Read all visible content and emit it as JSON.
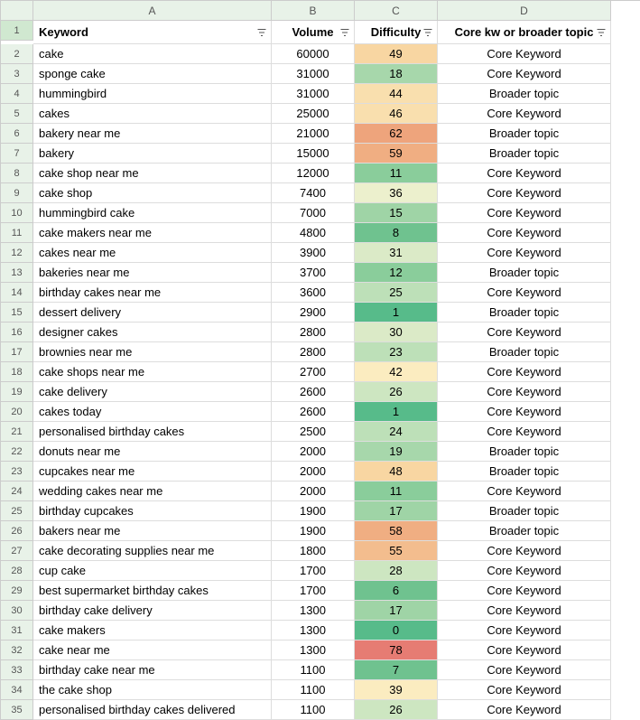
{
  "columns": [
    "A",
    "B",
    "C",
    "D"
  ],
  "headers": {
    "keyword": "Keyword",
    "volume": "Volume",
    "difficulty": "Difficulty",
    "topic": "Core kw or broader topic"
  },
  "rows": [
    {
      "n": 2,
      "keyword": "cake",
      "volume": "60000",
      "difficulty": 49,
      "topic": "Core Keyword"
    },
    {
      "n": 3,
      "keyword": "sponge cake",
      "volume": "31000",
      "difficulty": 18,
      "topic": "Core Keyword"
    },
    {
      "n": 4,
      "keyword": "hummingbird",
      "volume": "31000",
      "difficulty": 44,
      "topic": "Broader topic"
    },
    {
      "n": 5,
      "keyword": "cakes",
      "volume": "25000",
      "difficulty": 46,
      "topic": "Core Keyword"
    },
    {
      "n": 6,
      "keyword": "bakery near me",
      "volume": "21000",
      "difficulty": 62,
      "topic": "Broader topic"
    },
    {
      "n": 7,
      "keyword": "bakery",
      "volume": "15000",
      "difficulty": 59,
      "topic": "Broader topic"
    },
    {
      "n": 8,
      "keyword": "cake shop near me",
      "volume": "12000",
      "difficulty": 11,
      "topic": "Core Keyword"
    },
    {
      "n": 9,
      "keyword": "cake shop",
      "volume": "7400",
      "difficulty": 36,
      "topic": "Core Keyword"
    },
    {
      "n": 10,
      "keyword": "hummingbird cake",
      "volume": "7000",
      "difficulty": 15,
      "topic": "Core Keyword"
    },
    {
      "n": 11,
      "keyword": "cake makers near me",
      "volume": "4800",
      "difficulty": 8,
      "topic": "Core Keyword"
    },
    {
      "n": 12,
      "keyword": "cakes near me",
      "volume": "3900",
      "difficulty": 31,
      "topic": "Core Keyword"
    },
    {
      "n": 13,
      "keyword": "bakeries near me",
      "volume": "3700",
      "difficulty": 12,
      "topic": "Broader topic"
    },
    {
      "n": 14,
      "keyword": "birthday cakes near me",
      "volume": "3600",
      "difficulty": 25,
      "topic": "Core Keyword"
    },
    {
      "n": 15,
      "keyword": "dessert delivery",
      "volume": "2900",
      "difficulty": 1,
      "topic": "Broader topic"
    },
    {
      "n": 16,
      "keyword": "designer cakes",
      "volume": "2800",
      "difficulty": 30,
      "topic": "Core Keyword"
    },
    {
      "n": 17,
      "keyword": "brownies near me",
      "volume": "2800",
      "difficulty": 23,
      "topic": "Broader topic"
    },
    {
      "n": 18,
      "keyword": "cake shops near me",
      "volume": "2700",
      "difficulty": 42,
      "topic": "Core Keyword"
    },
    {
      "n": 19,
      "keyword": "cake delivery",
      "volume": "2600",
      "difficulty": 26,
      "topic": "Core Keyword"
    },
    {
      "n": 20,
      "keyword": "cakes today",
      "volume": "2600",
      "difficulty": 1,
      "topic": "Core Keyword"
    },
    {
      "n": 21,
      "keyword": "personalised birthday cakes",
      "volume": "2500",
      "difficulty": 24,
      "topic": "Core Keyword"
    },
    {
      "n": 22,
      "keyword": "donuts near me",
      "volume": "2000",
      "difficulty": 19,
      "topic": "Broader topic"
    },
    {
      "n": 23,
      "keyword": "cupcakes near me",
      "volume": "2000",
      "difficulty": 48,
      "topic": "Broader topic"
    },
    {
      "n": 24,
      "keyword": "wedding cakes near me",
      "volume": "2000",
      "difficulty": 11,
      "topic": "Core Keyword"
    },
    {
      "n": 25,
      "keyword": "birthday cupcakes",
      "volume": "1900",
      "difficulty": 17,
      "topic": "Broader topic"
    },
    {
      "n": 26,
      "keyword": "bakers near me",
      "volume": "1900",
      "difficulty": 58,
      "topic": "Broader topic"
    },
    {
      "n": 27,
      "keyword": "cake decorating supplies near me",
      "volume": "1800",
      "difficulty": 55,
      "topic": "Core Keyword"
    },
    {
      "n": 28,
      "keyword": "cup cake",
      "volume": "1700",
      "difficulty": 28,
      "topic": "Core Keyword"
    },
    {
      "n": 29,
      "keyword": "best supermarket birthday cakes",
      "volume": "1700",
      "difficulty": 6,
      "topic": "Core Keyword"
    },
    {
      "n": 30,
      "keyword": "birthday cake delivery",
      "volume": "1300",
      "difficulty": 17,
      "topic": "Core Keyword"
    },
    {
      "n": 31,
      "keyword": "cake makers",
      "volume": "1300",
      "difficulty": 0,
      "topic": "Core Keyword"
    },
    {
      "n": 32,
      "keyword": "cake near me",
      "volume": "1300",
      "difficulty": 78,
      "topic": "Core Keyword"
    },
    {
      "n": 33,
      "keyword": "birthday cake near me",
      "volume": "1100",
      "difficulty": 7,
      "topic": "Core Keyword"
    },
    {
      "n": 34,
      "keyword": "the cake shop",
      "volume": "1100",
      "difficulty": 39,
      "topic": "Core Keyword"
    },
    {
      "n": 35,
      "keyword": "personalised birthday cakes delivered",
      "volume": "1100",
      "difficulty": 26,
      "topic": "Core Keyword"
    }
  ]
}
